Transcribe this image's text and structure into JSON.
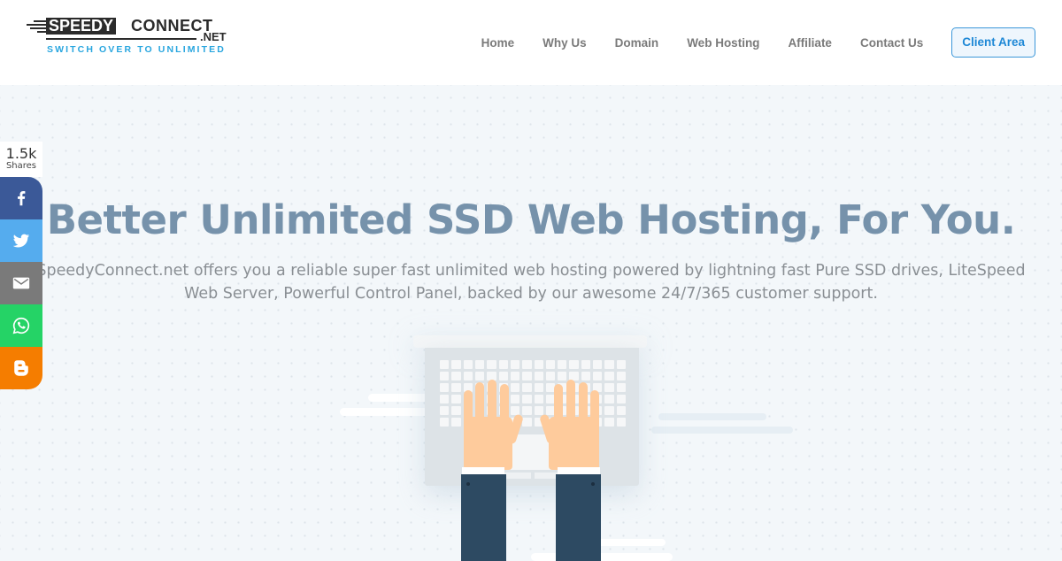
{
  "brand": {
    "speedy": "SPEEDY",
    "connect": "CONNECT",
    "net": ".NET",
    "tagline": "SWITCH OVER TO UNLIMITED",
    "accent_color": "#29a6df"
  },
  "nav": {
    "items": [
      {
        "label": "Home"
      },
      {
        "label": "Why Us"
      },
      {
        "label": "Domain"
      },
      {
        "label": "Web Hosting"
      },
      {
        "label": "Affiliate"
      },
      {
        "label": "Contact Us"
      }
    ],
    "client_area": "Client Area",
    "client_area_color": "#1e88d6"
  },
  "hero": {
    "headline": "Better Unlimited SSD Web Hosting, For You.",
    "subtext": "SpeedyConnect.net offers you a reliable super fast unlimited web hosting powered by lightning fast Pure SSD drives, LiteSpeed Web Server, Powerful Control Panel, backed by our awesome 24/7/365 customer support.",
    "headline_color": "#7692ab"
  },
  "share": {
    "count": "1.5k",
    "label": "Shares",
    "buttons": [
      {
        "network": "facebook",
        "icon": "facebook-icon",
        "color": "#3b5998"
      },
      {
        "network": "twitter",
        "icon": "twitter-icon",
        "color": "#55acee"
      },
      {
        "network": "email",
        "icon": "email-icon",
        "color": "#7a7a7a"
      },
      {
        "network": "whatsapp",
        "icon": "whatsapp-icon",
        "color": "#25d366"
      },
      {
        "network": "blogger",
        "icon": "blogger-icon",
        "color": "#f57d00"
      }
    ]
  }
}
